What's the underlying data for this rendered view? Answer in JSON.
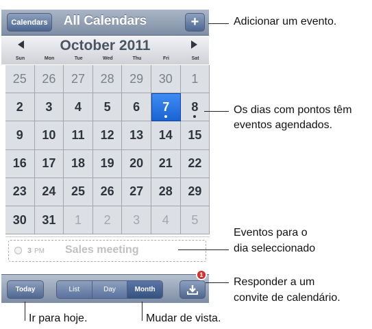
{
  "navbar": {
    "calendars_label": "Calendars",
    "title": "All Calendars",
    "add_label": "+"
  },
  "month": {
    "title": "October 2011",
    "weekdays": [
      "Sun",
      "Mon",
      "Tue",
      "Wed",
      "Thu",
      "Fri",
      "Sat"
    ]
  },
  "days": [
    [
      "25",
      "26",
      "27",
      "28",
      "29",
      "30",
      "1"
    ],
    [
      "2",
      "3",
      "4",
      "5",
      "6",
      "7",
      "8"
    ],
    [
      "9",
      "10",
      "11",
      "12",
      "13",
      "14",
      "15"
    ],
    [
      "16",
      "17",
      "18",
      "19",
      "20",
      "21",
      "22"
    ],
    [
      "23",
      "24",
      "25",
      "26",
      "27",
      "28",
      "29"
    ],
    [
      "30",
      "31",
      "1",
      "2",
      "3",
      "4",
      "5"
    ]
  ],
  "selected_day": "7",
  "event": {
    "time": "3",
    "ampm": "PM",
    "title": "Sales meeting"
  },
  "toolbar": {
    "today_label": "Today",
    "views": [
      "List",
      "Day",
      "Month"
    ],
    "selected_view": "Month",
    "badge_count": "1"
  },
  "callouts": {
    "add_event": "Adicionar um evento.",
    "dots_line1": "Os dias com pontos têm",
    "dots_line2": "eventos agendados.",
    "events_line1": "Eventos para o",
    "events_line2": "dia seleccionado",
    "respond_line1": "Responder a um",
    "respond_line2": "convite de calendário.",
    "go_today": "Ir para hoje.",
    "change_view": "Mudar de vista."
  },
  "colors": {
    "accent": "#1a63d2",
    "badge": "#c01010"
  }
}
